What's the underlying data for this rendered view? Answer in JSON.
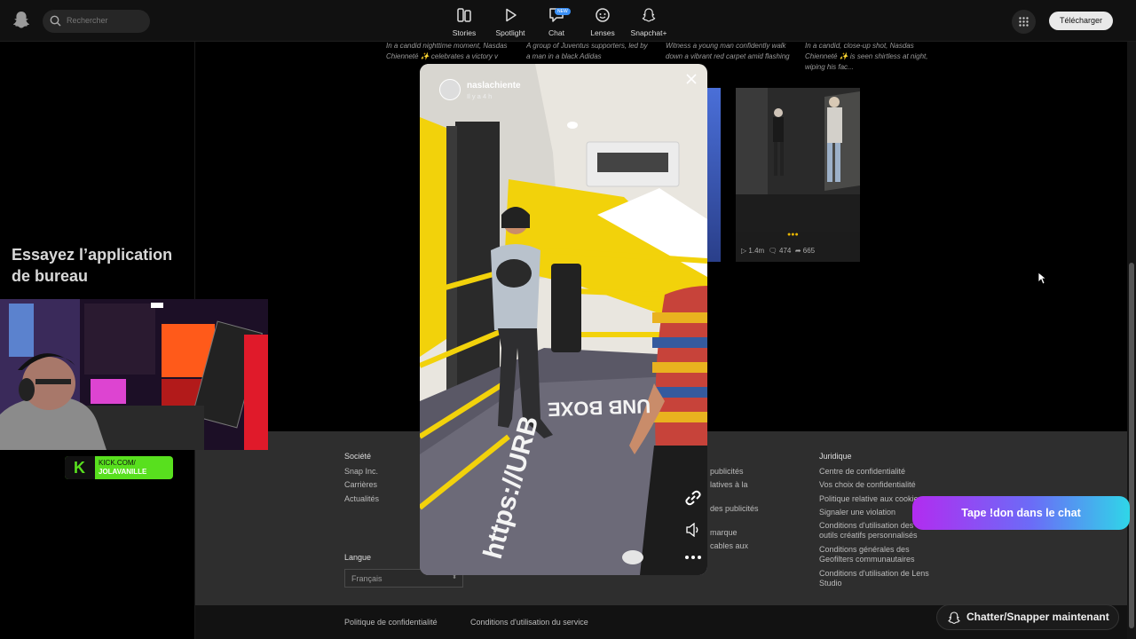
{
  "topbar": {
    "search_placeholder": "Rechercher",
    "nav": [
      {
        "label": "Stories",
        "icon": "stories-icon"
      },
      {
        "label": "Spotlight",
        "icon": "play-icon"
      },
      {
        "label": "Chat",
        "icon": "chat-icon",
        "badge": "NEW"
      },
      {
        "label": "Lenses",
        "icon": "lenses-icon"
      },
      {
        "label": "Snapchat+",
        "icon": "snapchat-plus-icon"
      }
    ],
    "download_label": "Télécharger"
  },
  "left_panel": {
    "promo_title": "Essayez l’application de bureau"
  },
  "captions": [
    "In a candid nighttime moment, Nasdas Chienneté ✨ celebrates a victory v",
    "A group of Juventus supporters, led by a man in a black Adidas",
    "Witness a young man confidently walk down a vibrant red carpet amid flashing lights....",
    "In a candid, close-up shot, Nasdas Chienneté ✨ is seen shirtless at night, wiping his fac..."
  ],
  "card": {
    "views": "1.4m",
    "comments": "474",
    "shares": "665"
  },
  "modal": {
    "username": "naslachiente",
    "time": "Il y a 4 h",
    "story_text_floor1": "UNB BOXE",
    "story_text_floor2": "https://URB"
  },
  "footer": {
    "societe": {
      "heading": "Société",
      "links": [
        "Snap Inc.",
        "Carrières",
        "Actualités"
      ]
    },
    "middle_links": [
      "publicités",
      "latives à la",
      "des publicités",
      "marque",
      "cables aux"
    ],
    "juridique": {
      "heading": "Juridique",
      "links": [
        "Centre de confidentialité",
        "Vos choix de confidentialité",
        "Politique relative aux cookies",
        "Signaler une violation",
        "Conditions d'utilisation des outils créatifs personnalisés",
        "Conditions générales des Geofilters communautaires",
        "Conditions d'utilisation de Lens Studio"
      ]
    },
    "langue_heading": "Langue",
    "langue_value": "Français",
    "bottom_links": [
      "Politique de confidentialité",
      "Conditions d'utilisation du service"
    ]
  },
  "overlay": {
    "kick_line1": "KICK.COM/",
    "kick_line2": "JOLAVANILLE",
    "tape_banner": "Tape !don dans le chat",
    "chat_now": "Chatter/Snapper maintenant"
  },
  "colors": {
    "accent_yellow": "#f2d20b",
    "kick_green": "#58e01e",
    "footer_bg": "#2e2e2e"
  }
}
